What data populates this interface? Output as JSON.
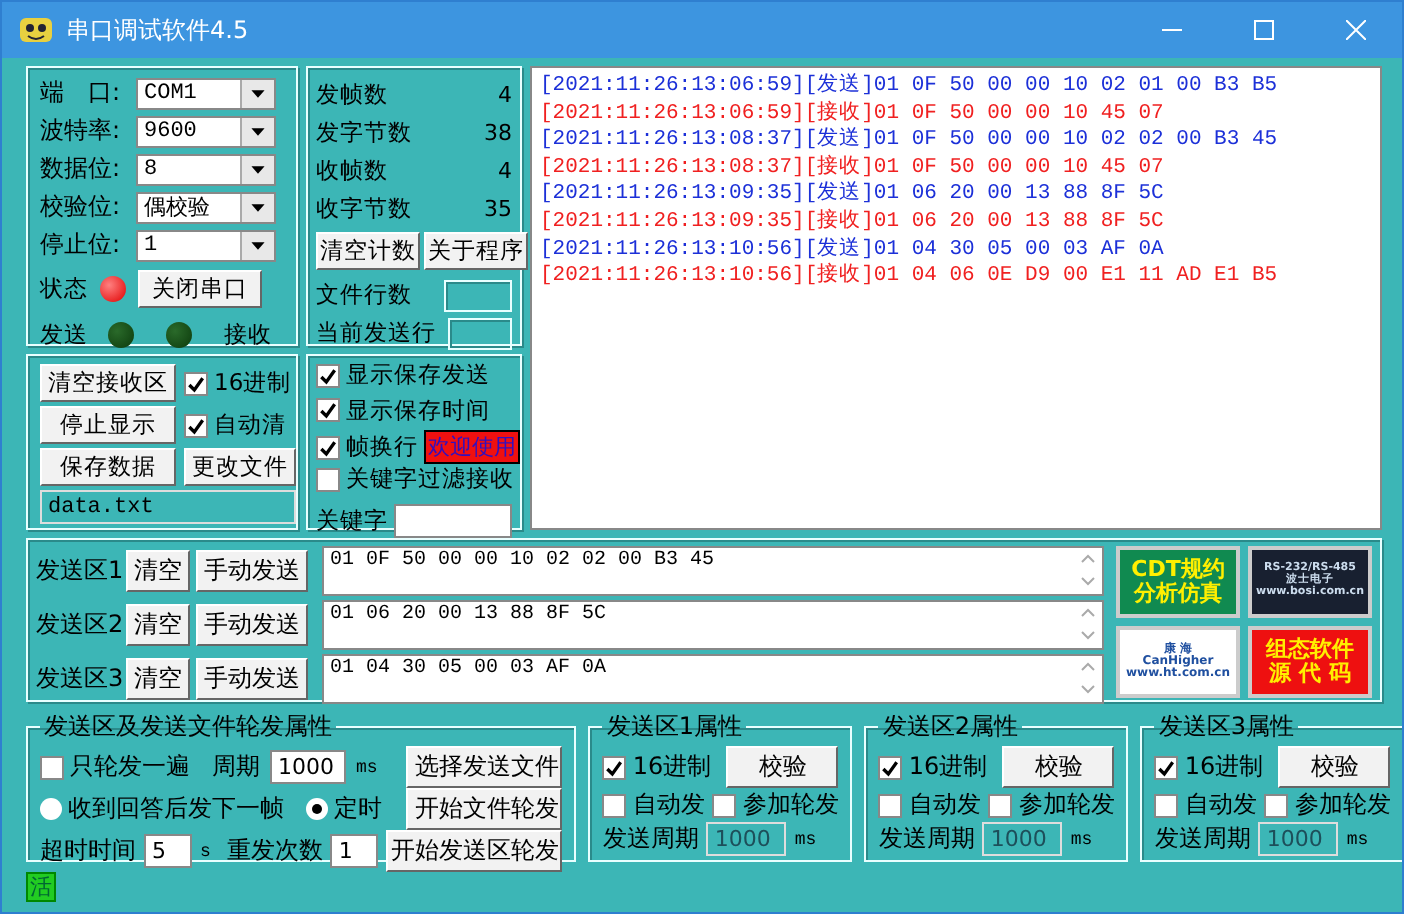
{
  "window": {
    "title": "串口调试软件4.5"
  },
  "port_settings": {
    "fields": [
      {
        "label": "端　口:",
        "value": "COM1"
      },
      {
        "label": "波特率:",
        "value": "9600"
      },
      {
        "label": "数据位:",
        "value": "8"
      },
      {
        "label": "校验位:",
        "value": "偶校验"
      },
      {
        "label": "停止位:",
        "value": "1"
      }
    ],
    "status": {
      "label": "状态",
      "on": true
    },
    "close_button": "关闭串口",
    "indicators": [
      {
        "label": "发送",
        "on": false
      },
      {
        "label": "接收",
        "on": false
      }
    ]
  },
  "counters": {
    "items": [
      {
        "label": "发帧数",
        "value": "4"
      },
      {
        "label": "发字节数",
        "value": "38"
      },
      {
        "label": "收帧数",
        "value": "4"
      },
      {
        "label": "收字节数",
        "value": "35"
      }
    ],
    "buttons": [
      "清空计数",
      "关于程序"
    ],
    "fields": [
      {
        "label": "文件行数"
      },
      {
        "label": "当前发送行"
      }
    ]
  },
  "receive_controls": {
    "buttons": [
      "清空接收区",
      "停止显示",
      "保存数据",
      "更改文件"
    ],
    "checkboxes": [
      {
        "label": "16进制",
        "checked": true
      },
      {
        "label": "自动清",
        "checked": true
      }
    ],
    "file_name": "data.txt"
  },
  "display_options": {
    "checkboxes": [
      {
        "label": "显示保存发送",
        "checked": true
      },
      {
        "label": "显示保存时间",
        "checked": true
      },
      {
        "label": "帧换行",
        "checked": true
      },
      {
        "label": "关键字过滤接收",
        "checked": false
      }
    ],
    "badge": "欢迎使用",
    "keyword_label": "关键字"
  },
  "receive_log": [
    {
      "kind": "send",
      "text": "[2021:11:26:13:06:59][发送]01 0F 50 00 00 10 02 01 00 B3 B5"
    },
    {
      "kind": "receive",
      "text": "[2021:11:26:13:06:59][接收]01 0F 50 00 00 10 45 07"
    },
    {
      "kind": "send",
      "text": "[2021:11:26:13:08:37][发送]01 0F 50 00 00 10 02 02 00 B3 45"
    },
    {
      "kind": "receive",
      "text": "[2021:11:26:13:08:37][接收]01 0F 50 00 00 10 45 07"
    },
    {
      "kind": "send",
      "text": "[2021:11:26:13:09:35][发送]01 06 20 00 13 88 8F 5C"
    },
    {
      "kind": "receive",
      "text": "[2021:11:26:13:09:35][接收]01 06 20 00 13 88 8F 5C"
    },
    {
      "kind": "send",
      "text": "[2021:11:26:13:10:56][发送]01 04 30 05 00 03 AF 0A"
    },
    {
      "kind": "receive",
      "text": "[2021:11:26:13:10:56][接收]01 04 06 0E D9 00 E1 11 AD E1 B5"
    }
  ],
  "send_zones": [
    {
      "label": "发送区1",
      "clear": "清空",
      "send": "手动发送",
      "value": "01 0F 50 00 00 10 02 02 00 B3 45"
    },
    {
      "label": "发送区2",
      "clear": "清空",
      "send": "手动发送",
      "value": "01 06 20 00 13 88 8F 5C"
    },
    {
      "label": "发送区3",
      "clear": "清空",
      "send": "手动发送",
      "value": "01 04 30 05 00 03 AF 0A"
    }
  ],
  "banners": [
    {
      "kind": "cdt",
      "lines": [
        "CDT规约",
        "分析仿真"
      ]
    },
    {
      "kind": "bosi",
      "lines": [
        "RS-232/RS-485",
        "波士电子",
        "www.bosi.com.cn"
      ]
    },
    {
      "kind": "canhigher",
      "lines": [
        "康 海",
        "CanHigher",
        "www.ht.com.cn"
      ]
    },
    {
      "kind": "source",
      "lines": [
        "组态软件",
        "源 代 码"
      ]
    }
  ],
  "polling": {
    "title": "发送区及发送文件轮发属性",
    "once": {
      "label": "只轮发一遍",
      "checked": false
    },
    "period_label": "周期",
    "period": "1000",
    "period_unit": "ms",
    "modes": [
      {
        "label": "收到回答后发下一帧",
        "selected": false
      },
      {
        "label": "定时",
        "selected": true
      }
    ],
    "timeout_label": "超时时间",
    "timeout": "5",
    "timeout_unit": "s",
    "retries_label": "重发次数",
    "retries": "1",
    "buttons": [
      "选择发送文件",
      "开始文件轮发",
      "开始发送区轮发"
    ]
  },
  "zone_properties": [
    {
      "title": "发送区1属性",
      "hex": {
        "label": "16进制",
        "checked": true
      },
      "check_button": "校验",
      "auto": {
        "label": "自动发",
        "checked": false
      },
      "poll": {
        "label": "参加轮发",
        "checked": false
      },
      "period_label": "发送周期",
      "period": "1000",
      "period_disabled": true,
      "unit": "ms"
    },
    {
      "title": "发送区2属性",
      "hex": {
        "label": "16进制",
        "checked": true
      },
      "check_button": "校验",
      "auto": {
        "label": "自动发",
        "checked": false
      },
      "poll": {
        "label": "参加轮发",
        "checked": false
      },
      "period_label": "发送周期",
      "period": "1000",
      "period_disabled": true,
      "unit": "ms"
    },
    {
      "title": "发送区3属性",
      "hex": {
        "label": "16进制",
        "checked": true
      },
      "check_button": "校验",
      "auto": {
        "label": "自动发",
        "checked": false
      },
      "poll": {
        "label": "参加轮发",
        "checked": false
      },
      "period_label": "发送周期",
      "period": "1000",
      "period_disabled": true,
      "unit": "ms"
    }
  ],
  "status_bar": {
    "badge": "活"
  }
}
